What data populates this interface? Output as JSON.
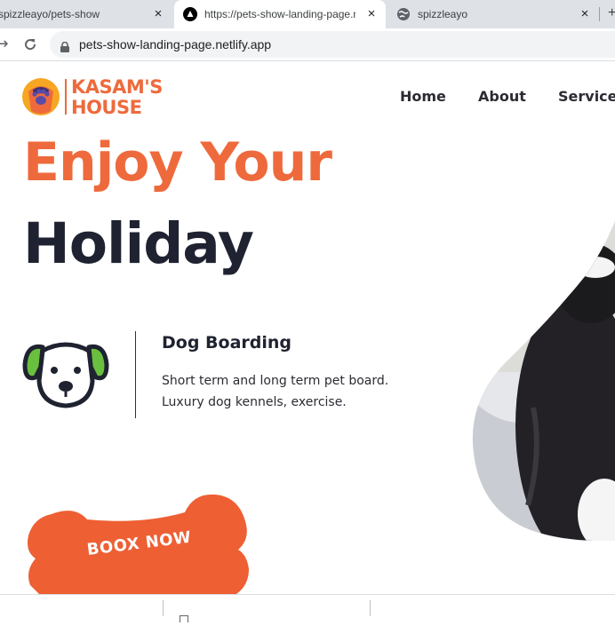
{
  "browser": {
    "tabs": [
      {
        "title": "spizzleayo/pets-show",
        "active": false,
        "close": "×"
      },
      {
        "title": "https://pets-show-landing-page.netlify.app",
        "active": true,
        "close": "×"
      },
      {
        "title": "spizzleayo",
        "active": false,
        "close": "×"
      }
    ],
    "new_tab": "+",
    "url": "pets-show-landing-page.netlify.app"
  },
  "site": {
    "logo": {
      "line1": "KASAM'S",
      "line2": "HOUSE"
    },
    "nav": [
      {
        "label": "Home"
      },
      {
        "label": "About"
      },
      {
        "label": "Services"
      }
    ],
    "hero": {
      "line1": "Enjoy Your",
      "line2": "Holiday"
    },
    "service": {
      "title": "Dog Boarding",
      "desc_line1": "Short term and long term pet board.",
      "desc_line2": "Luxury dog kennels, exercise."
    },
    "cta": {
      "label": "BOOX NOW"
    }
  },
  "colors": {
    "accent": "#ee6a3c",
    "dark": "#1f2230",
    "dog_ear": "#6abf3f"
  },
  "icons": [
    "paw-logo-icon",
    "dog-face-icon",
    "lock-icon",
    "github-favicon-icon",
    "globe-favicon-icon"
  ]
}
